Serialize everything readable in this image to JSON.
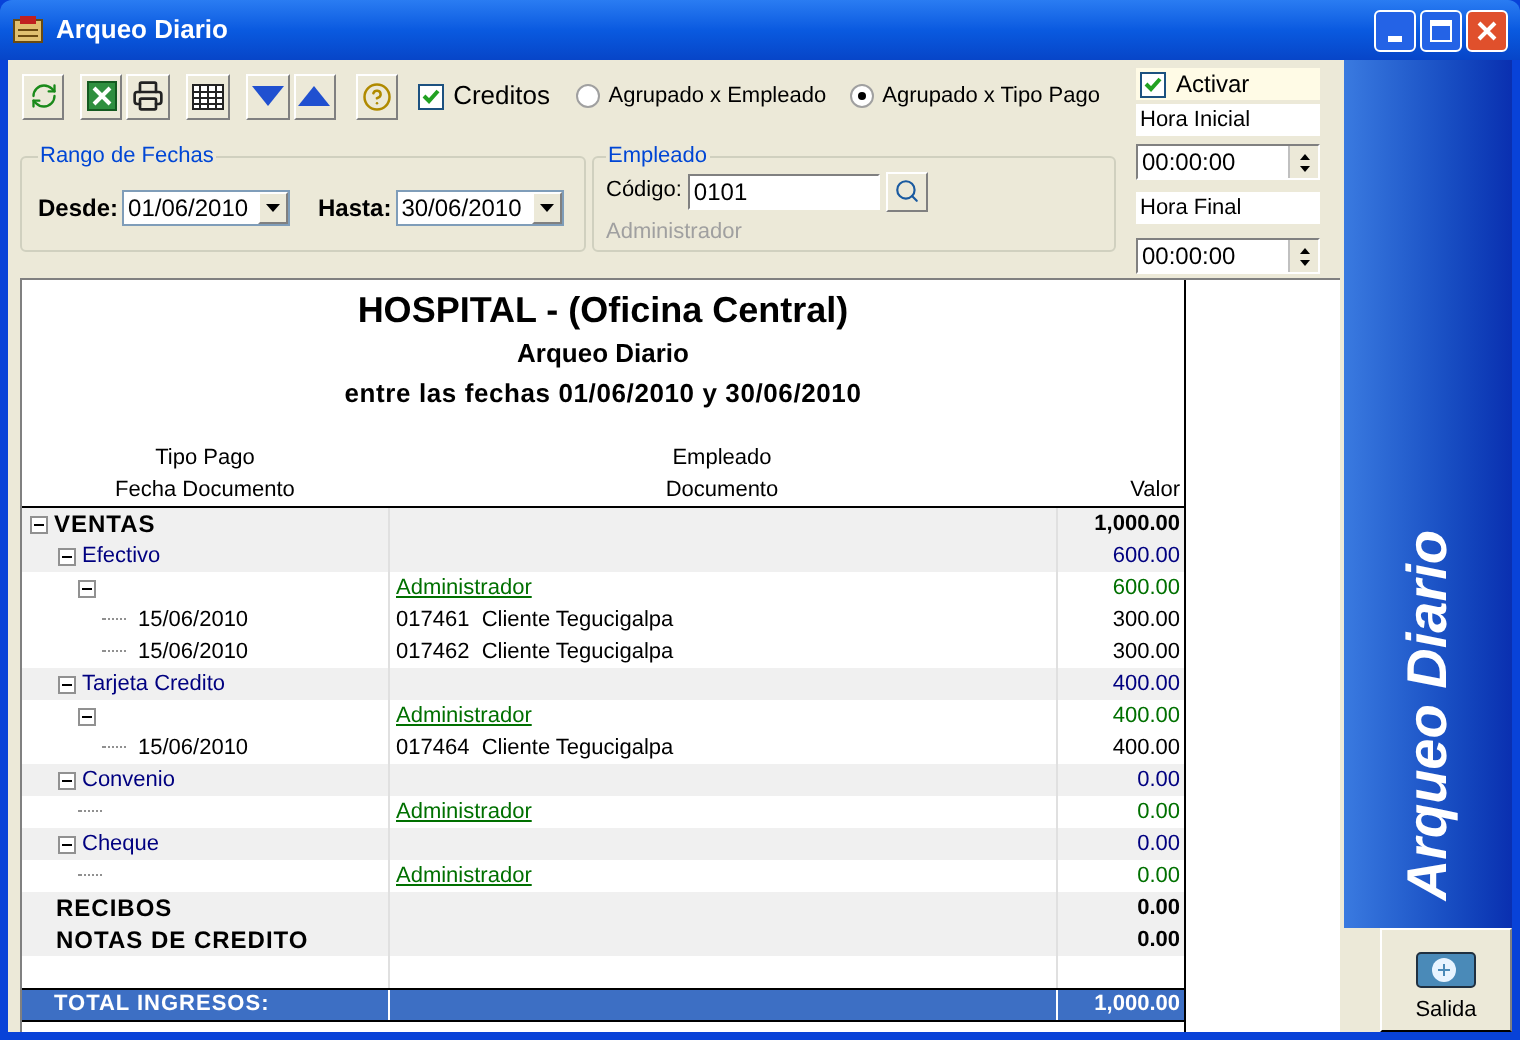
{
  "window": {
    "title": "Arqueo Diario"
  },
  "creditos": {
    "label": "Creditos",
    "checked": true
  },
  "grouping": [
    {
      "label": "Agrupado x Empleado",
      "selected": false
    },
    {
      "label": "Agrupado x Tipo Pago",
      "selected": true
    }
  ],
  "time_filter": {
    "activar": {
      "label": "Activar",
      "checked": true
    },
    "start_label": "Hora Inicial",
    "start_value": "00:00:00",
    "end_label": "Hora Final",
    "end_value": "00:00:00"
  },
  "date_range": {
    "title": "Rango de Fechas",
    "from_label": "Desde:",
    "from_value": "01/06/2010",
    "to_label": "Hasta:",
    "to_value": "30/06/2010"
  },
  "employee": {
    "title": "Empleado",
    "code_label": "Código:",
    "code_value": "0101",
    "name": "Administrador"
  },
  "report": {
    "title": "HOSPITAL - (Oficina Central)",
    "subtitle": "Arqueo Diario",
    "range": "entre las fechas 01/06/2010 y 30/06/2010",
    "columns": [
      {
        "top": "Tipo Pago",
        "bottom": "Fecha Documento"
      },
      {
        "top": "Empleado",
        "bottom": "Documento"
      },
      {
        "bottom": "Valor"
      }
    ],
    "rows": [
      {
        "kind": "section",
        "label": "VENTAS",
        "value": "1,000.00",
        "expanded": true,
        "children": [
          {
            "kind": "payment_type",
            "label": "Efectivo",
            "value": "600.00",
            "expanded": true,
            "children": [
              {
                "kind": "employee",
                "employee": "Administrador",
                "value": "600.00",
                "expanded": true,
                "children": [
                  {
                    "kind": "document",
                    "date": "15/06/2010",
                    "document": "017461  Cliente Tegucigalpa",
                    "value": "300.00"
                  },
                  {
                    "kind": "document",
                    "date": "15/06/2010",
                    "document": "017462  Cliente Tegucigalpa",
                    "value": "300.00"
                  }
                ]
              }
            ]
          },
          {
            "kind": "payment_type",
            "label": "Tarjeta Credito",
            "value": "400.00",
            "expanded": true,
            "children": [
              {
                "kind": "employee",
                "employee": "Administrador",
                "value": "400.00",
                "expanded": true,
                "children": [
                  {
                    "kind": "document",
                    "date": "15/06/2010",
                    "document": "017464  Cliente Tegucigalpa",
                    "value": "400.00"
                  }
                ]
              }
            ]
          },
          {
            "kind": "payment_type",
            "label": "Convenio",
            "value": "0.00",
            "expanded": true,
            "children": [
              {
                "kind": "employee",
                "employee": "Administrador",
                "value": "0.00"
              }
            ]
          },
          {
            "kind": "payment_type",
            "label": "Cheque",
            "value": "0.00",
            "expanded": true,
            "children": [
              {
                "kind": "employee",
                "employee": "Administrador",
                "value": "0.00"
              }
            ]
          }
        ]
      },
      {
        "kind": "section",
        "label": "RECIBOS",
        "value": "0.00"
      },
      {
        "kind": "section",
        "label": "NOTAS DE CREDITO",
        "value": "0.00"
      }
    ],
    "total": {
      "label": "TOTAL INGRESOS:",
      "value": "1,000.00"
    }
  },
  "side_title": "Arqueo Diario",
  "exit_button": {
    "label": "Salida"
  }
}
